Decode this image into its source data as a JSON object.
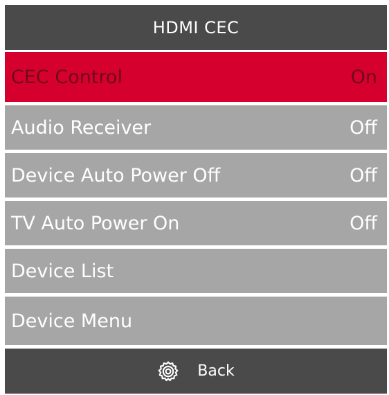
{
  "menu": {
    "title": "HDMI CEC",
    "items": [
      {
        "label": "CEC Control",
        "value": "On",
        "selected": true
      },
      {
        "label": "Audio Receiver",
        "value": "Off"
      },
      {
        "label": "Device Auto Power Off",
        "value": "Off"
      },
      {
        "label": "TV Auto Power On",
        "value": "Off"
      },
      {
        "label": "Device List",
        "value": ""
      },
      {
        "label": "Device Menu",
        "value": ""
      }
    ]
  },
  "footer": {
    "back_label": "Back",
    "back_icon": "gear-icon"
  },
  "colors": {
    "header_bg": "#4a4a4a",
    "item_bg": "#a6a6a6",
    "selected_bg": "#d6002e",
    "selected_text": "#6e0a1a",
    "text": "#ffffff"
  }
}
